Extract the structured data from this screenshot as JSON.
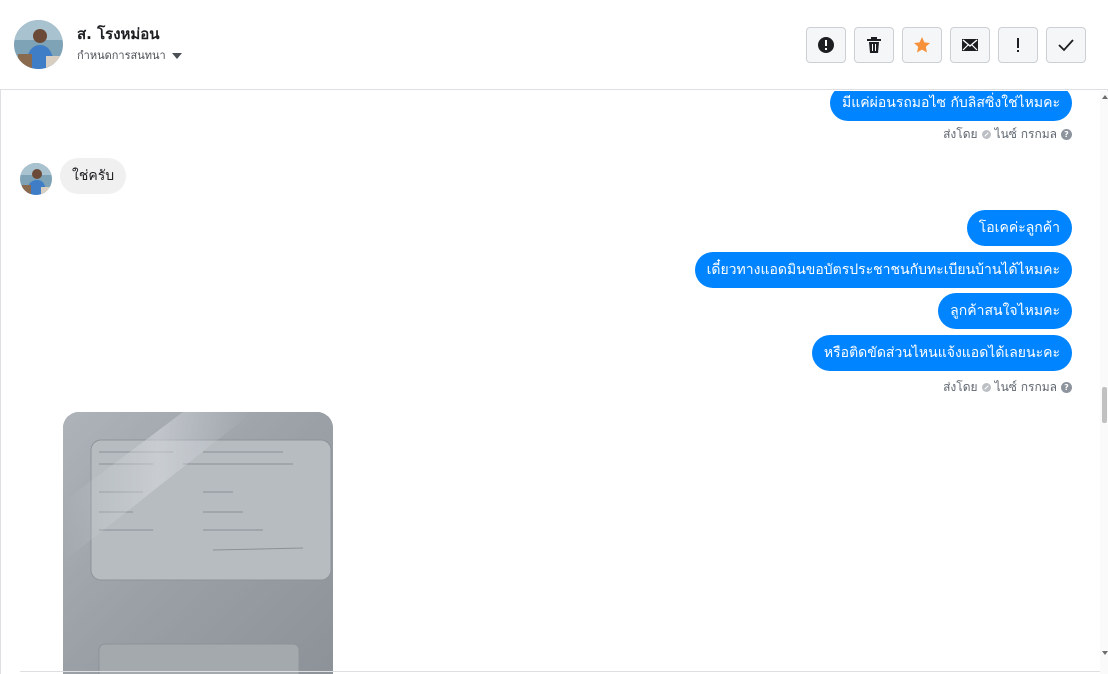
{
  "header": {
    "contact_name": "ส. โรงหม่อน",
    "assign_label": "กำหนดการสนทนา",
    "actions": [
      {
        "name": "spam-button",
        "icon": "exclamation-circle-icon"
      },
      {
        "name": "delete-button",
        "icon": "trash-icon"
      },
      {
        "name": "star-button",
        "icon": "star-icon",
        "color": "#f7923b"
      },
      {
        "name": "mark-unread-button",
        "icon": "envelope-icon"
      },
      {
        "name": "follow-up-button",
        "icon": "exclamation-icon"
      },
      {
        "name": "done-button",
        "icon": "checkmark-icon"
      }
    ]
  },
  "thread": {
    "msg_top_out": "มีแค่ผ่อนรถมอไซ กับลิสซิ่งใช่ไหมคะ",
    "msg_in": "ใช่ครับ",
    "msgs_out": [
      "โอเคค่ะลูกค้า",
      "เดี๋ยวทางแอดมินขอบัตรประชาชนกับทะเบียนบ้านได้ไหมคะ",
      "ลูกค้าสนใจไหมคะ",
      "หรือติดขัดส่วนไหนแจ้งแอดได้เลยนะคะ"
    ],
    "sent_by_1": {
      "prefix": "ส่งโดย",
      "sender": "ไนซ์ กรกมล",
      "help": "?"
    },
    "sent_by_2": {
      "prefix": "ส่งโดย",
      "sender": "ไนซ์ กรกมล",
      "help": "?"
    }
  },
  "colors": {
    "outgoing_bubble": "#0084ff",
    "incoming_bubble": "#f1f0f0",
    "star": "#f7923b"
  }
}
